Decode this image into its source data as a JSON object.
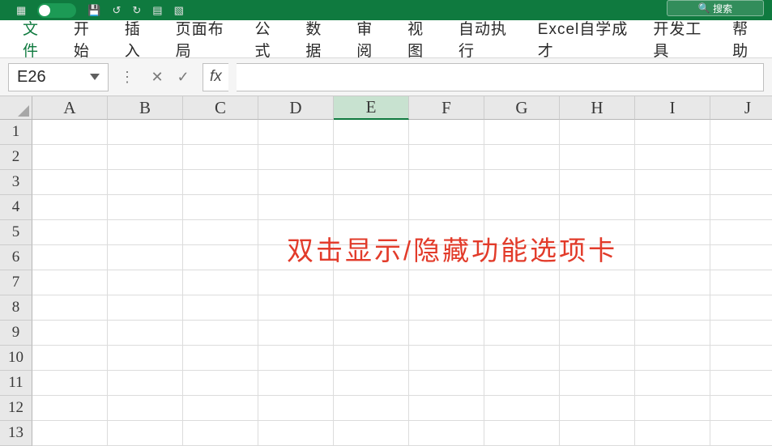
{
  "titlebar": {
    "search_label": "搜索"
  },
  "ribbon": {
    "tabs": [
      "文件",
      "开始",
      "插入",
      "页面布局",
      "公式",
      "数据",
      "审阅",
      "视图",
      "自动执行",
      "Excel自学成才",
      "开发工具",
      "帮助"
    ],
    "active_index": 0
  },
  "formula_bar": {
    "namebox_value": "E26",
    "fx_label": "fx"
  },
  "grid": {
    "columns": [
      "A",
      "B",
      "C",
      "D",
      "E",
      "F",
      "G",
      "H",
      "I",
      "J"
    ],
    "active_column": "E",
    "rows": [
      1,
      2,
      3,
      4,
      5,
      6,
      7,
      8,
      9,
      10,
      11,
      12,
      13
    ]
  },
  "overlay": {
    "hint_text": "双击显示/隐藏功能选项卡"
  }
}
